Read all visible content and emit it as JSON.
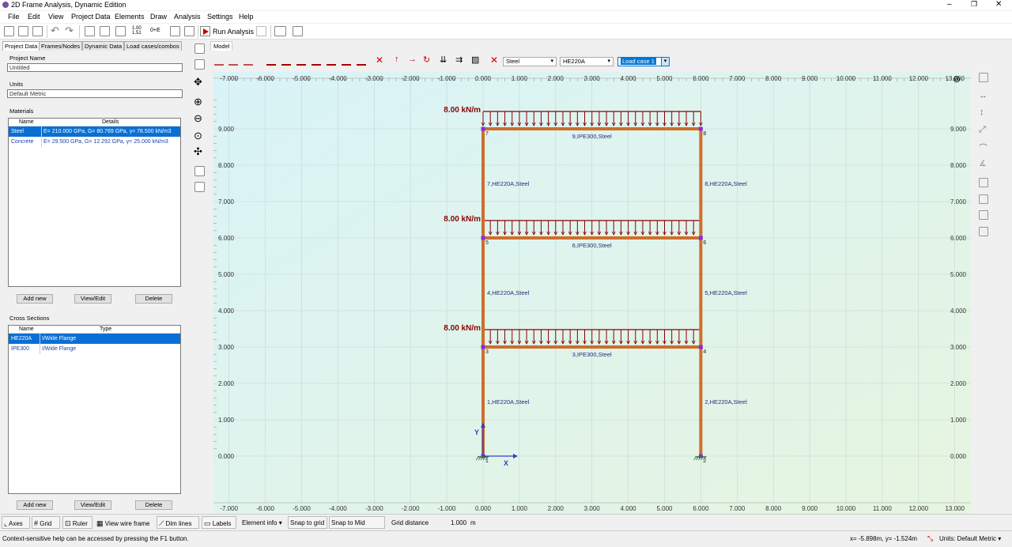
{
  "window": {
    "title": "2D Frame Analysis, Dynamic Edition"
  },
  "menu": [
    "File",
    "Edit",
    "View",
    "Project Data",
    "Elements",
    "Draw",
    "Analysis",
    "Settings",
    "Help"
  ],
  "toolbar": {
    "run_label": "Run Analysis"
  },
  "left_tabs": [
    "Project Data",
    "Frames/Nodes",
    "Dynamic Data",
    "Load cases/combos"
  ],
  "project": {
    "name_label": "Project Name",
    "name_value": "Untitled",
    "units_label": "Units",
    "units_value": "Default Metric",
    "materials_label": "Materials",
    "materials_columns": [
      "Name",
      "Details"
    ],
    "materials": [
      {
        "name": "Steel",
        "details": "E= 210.000 GPa, G= 80.769 GPa, γ= 78.500 kN/m3"
      },
      {
        "name": "Concrete",
        "details": "E= 29.500 GPa, G= 12.292 GPa, γ= 25.000 kN/m3"
      }
    ],
    "sections_label": "Cross Sections",
    "sections_columns": [
      "Name",
      "Type"
    ],
    "sections": [
      {
        "name": "HE220A",
        "type": "I/Wide Flange"
      },
      {
        "name": "IPE300",
        "type": "I/Wide Flange"
      }
    ],
    "add_new": "Add new",
    "view_edit": "View/Edit",
    "delete": "Delete"
  },
  "model_tab": "Model",
  "draw_toolbar": {
    "material": "Steel",
    "section": "HE220A",
    "load_case": "Load case 1"
  },
  "chart_data": {
    "type": "structural-frame",
    "x_axis_labels": [
      "-7.000",
      "-6.000",
      "-5.000",
      "-4.000",
      "-3.000",
      "-2.000",
      "-1.000",
      "0.000",
      "1.000",
      "2.000",
      "3.000",
      "4.000",
      "5.000",
      "6.000",
      "7.000",
      "8.000",
      "9.000",
      "10.000",
      "11.000",
      "12.000",
      "13.000"
    ],
    "x_values": [
      -7,
      -6,
      -5,
      -4,
      -3,
      -2,
      -1,
      0,
      1,
      2,
      3,
      4,
      5,
      6,
      7,
      8,
      9,
      10,
      11,
      12,
      13
    ],
    "y_axis_labels": [
      "0.000",
      "1.000",
      "2.000",
      "3.000",
      "4.000",
      "5.000",
      "6.000",
      "7.000",
      "8.000",
      "9.000"
    ],
    "y_values": [
      0,
      1,
      2,
      3,
      4,
      5,
      6,
      7,
      8,
      9
    ],
    "nodes": [
      {
        "id": "1",
        "x": 0,
        "y": 0
      },
      {
        "id": "2",
        "x": 6,
        "y": 0
      },
      {
        "id": "3",
        "x": 0,
        "y": 3
      },
      {
        "id": "4",
        "x": 6,
        "y": 3
      },
      {
        "id": "5",
        "x": 0,
        "y": 6
      },
      {
        "id": "6",
        "x": 6,
        "y": 6
      },
      {
        "id": "7",
        "x": 0,
        "y": 9
      },
      {
        "id": "8",
        "x": 6,
        "y": 9
      }
    ],
    "elements": [
      {
        "label": "1,HE220A,Steel",
        "from": "1",
        "to": "3"
      },
      {
        "label": "2,HE220A,Steel",
        "from": "2",
        "to": "4"
      },
      {
        "label": "3,IPE300,Steel",
        "from": "3",
        "to": "4"
      },
      {
        "label": "4,HE220A,Steel",
        "from": "3",
        "to": "5"
      },
      {
        "label": "5,HE220A,Steel",
        "from": "4",
        "to": "6"
      },
      {
        "label": "6,IPE300,Steel",
        "from": "5",
        "to": "6"
      },
      {
        "label": "7,HE220A,Steel",
        "from": "5",
        "to": "7"
      },
      {
        "label": "8,HE220A,Steel",
        "from": "6",
        "to": "8"
      },
      {
        "label": "9,IPE300,Steel",
        "from": "7",
        "to": "8"
      }
    ],
    "loads": [
      {
        "label": "8.00 kN/m",
        "y": 3
      },
      {
        "label": "8.00 kN/m",
        "y": 6
      },
      {
        "label": "8.00 kN/m",
        "y": 9
      }
    ],
    "axis_x_label": "X",
    "axis_y_label": "Y",
    "grid": true
  },
  "bottom_bar": {
    "axes": "Axes",
    "grid": "Grid",
    "ruler": "Ruler",
    "wire": "View wire frame",
    "dim": "Dim lines",
    "labels": "Labels",
    "elinfo": "Element info",
    "snap_grid": "Snap to grid",
    "snap_mid": "Snap to Mid points",
    "grid_distance_label": "Grid distance",
    "grid_distance_value": "1.000",
    "grid_distance_unit": "m"
  },
  "status": {
    "help": "Context-sensitive help can be accessed by pressing the F1 button.",
    "coords": "x= -5.898m, y= -1.524m",
    "units": "Units: Default Metric"
  }
}
